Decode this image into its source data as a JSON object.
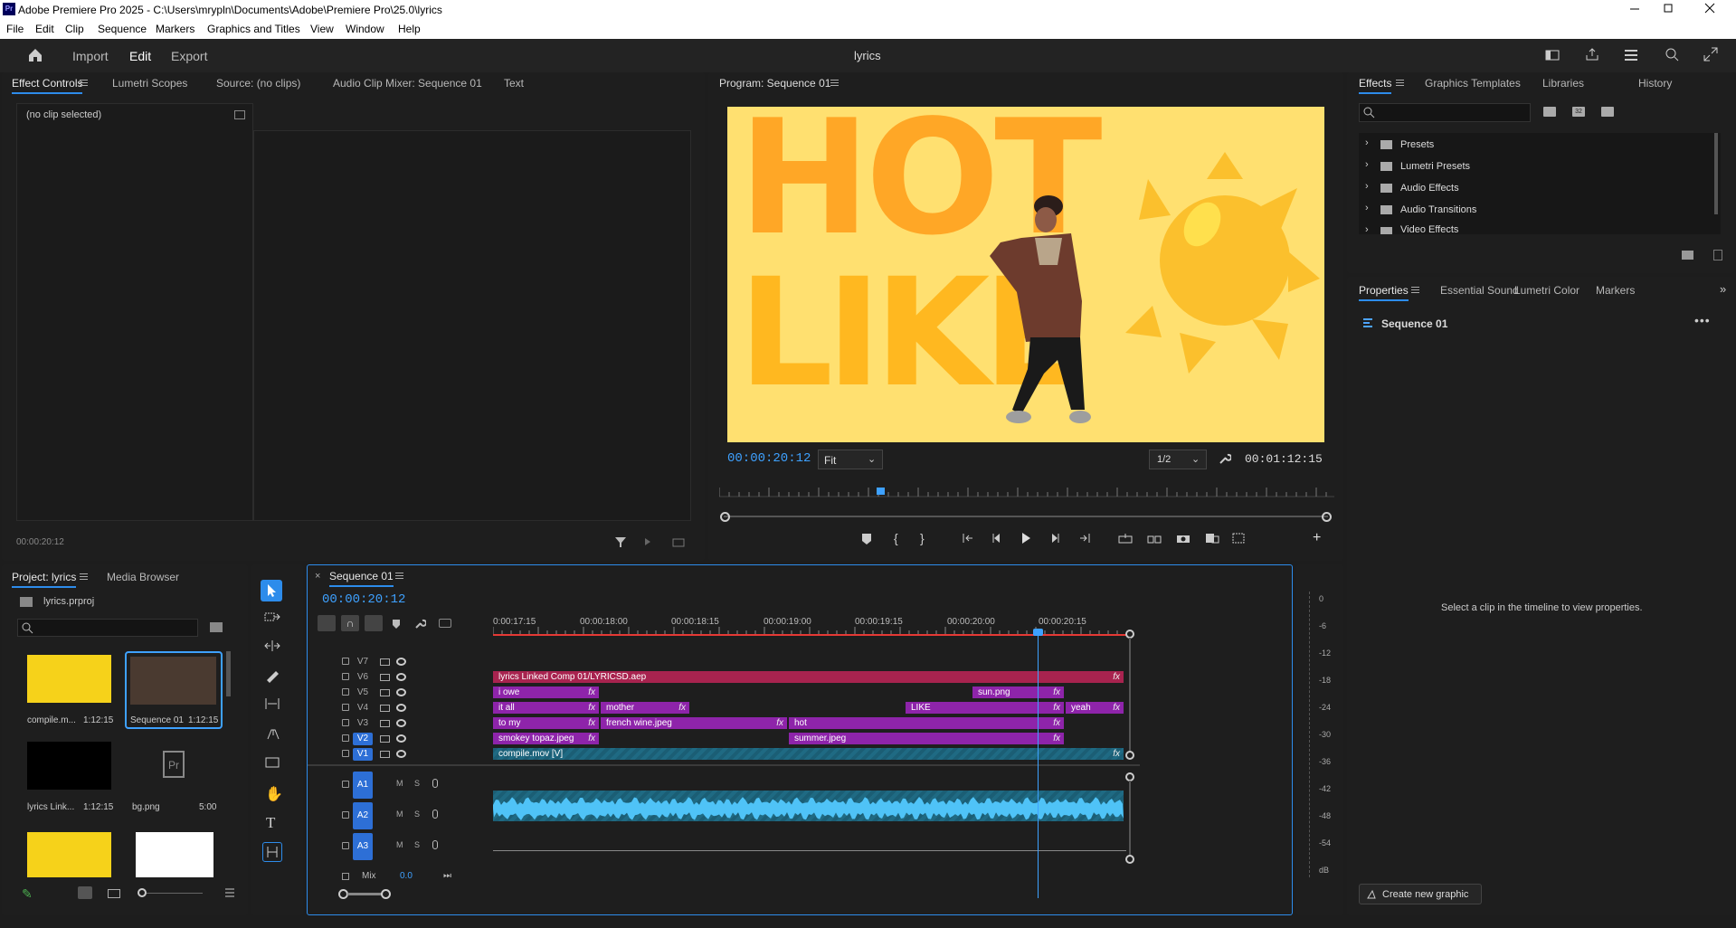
{
  "titlebar": {
    "app_icon": "Pr",
    "title": "Adobe Premiere Pro 2025 - C:\\Users\\mrypln\\Documents\\Adobe\\Premiere Pro\\25.0\\lyrics"
  },
  "menu": [
    "File",
    "Edit",
    "Clip",
    "Sequence",
    "Markers",
    "Graphics and Titles",
    "View",
    "Window",
    "Help"
  ],
  "appbar": {
    "import": "Import",
    "edit": "Edit",
    "export": "Export",
    "project_title": "lyrics"
  },
  "effect_controls": {
    "tabs": [
      "Effect Controls",
      "Lumetri Scopes",
      "Source: (no clips)",
      "Audio Clip Mixer: Sequence 01",
      "Text"
    ],
    "no_clip": "(no clip selected)",
    "timecode": "00:00:20:12"
  },
  "program": {
    "tab": "Program: Sequence 01",
    "timecode": "00:00:20:12",
    "fit": "Fit",
    "resolution": "1/2",
    "duration": "00:01:12:15",
    "artwork": {
      "word1": "HOT",
      "word2": "LIKE",
      "bg": "#ffe070",
      "text_color": "#ffa726"
    }
  },
  "effects": {
    "tabs": [
      "Effects",
      "Graphics Templates",
      "Libraries",
      "History"
    ],
    "items": [
      "Presets",
      "Lumetri Presets",
      "Audio Effects",
      "Audio Transitions",
      "Video Effects"
    ]
  },
  "properties": {
    "tabs": [
      "Properties",
      "Essential Sound",
      "Lumetri Color",
      "Markers"
    ],
    "sequence": "Sequence 01",
    "hint": "Select a clip in the timeline to view properties.",
    "create": "Create new graphic"
  },
  "project": {
    "tabs": [
      "Project: lyrics",
      "Media Browser"
    ],
    "file": "lyrics.prproj",
    "items": [
      {
        "name": "compile.m...",
        "dur": "1:12:15"
      },
      {
        "name": "Sequence 01",
        "dur": "1:12:15"
      },
      {
        "name": "lyrics Link...",
        "dur": "1:12:15"
      },
      {
        "name": "bg.png",
        "dur": "5:00"
      }
    ]
  },
  "timeline": {
    "tab": "Sequence 01",
    "timecode": "00:00:20:12",
    "ruler": [
      "0:00:17:15",
      "00:00:18:00",
      "00:00:18:15",
      "00:00:19:00",
      "00:00:19:15",
      "00:00:20:00",
      "00:00:20:15"
    ],
    "video_tracks": [
      "V7",
      "V6",
      "V5",
      "V4",
      "V3",
      "V2",
      "V1"
    ],
    "audio_tracks": [
      "A1",
      "A2",
      "A3"
    ],
    "mix_label": "Mix",
    "mix_value": "0.0",
    "clips": {
      "v6_0": "lyrics Linked Comp 01/LYRICSD.aep",
      "v5_0": "i owe",
      "v5_1": "sun.png",
      "v4_0": "it all",
      "v4_1": "mother",
      "v4_2": "LIKE",
      "v4_3": "yeah",
      "v3_0": "to my",
      "v3_1": "french wine.jpeg",
      "v3_2": "hot",
      "v2_0": "smokey topaz.jpeg",
      "v2_1": "summer.jpeg",
      "v1_0": "compile.mov [V]",
      "fx": "fx"
    },
    "meter": [
      "0",
      "-6",
      "-12",
      "-18",
      "-24",
      "-30",
      "-36",
      "-42",
      "-48",
      "-54",
      "dB"
    ]
  },
  "colors": {
    "accent": "#2d8ceb",
    "clip_pink": "#b31f5e",
    "clip_purple": "#8e24aa",
    "clip_teal": "#1b5e75"
  }
}
